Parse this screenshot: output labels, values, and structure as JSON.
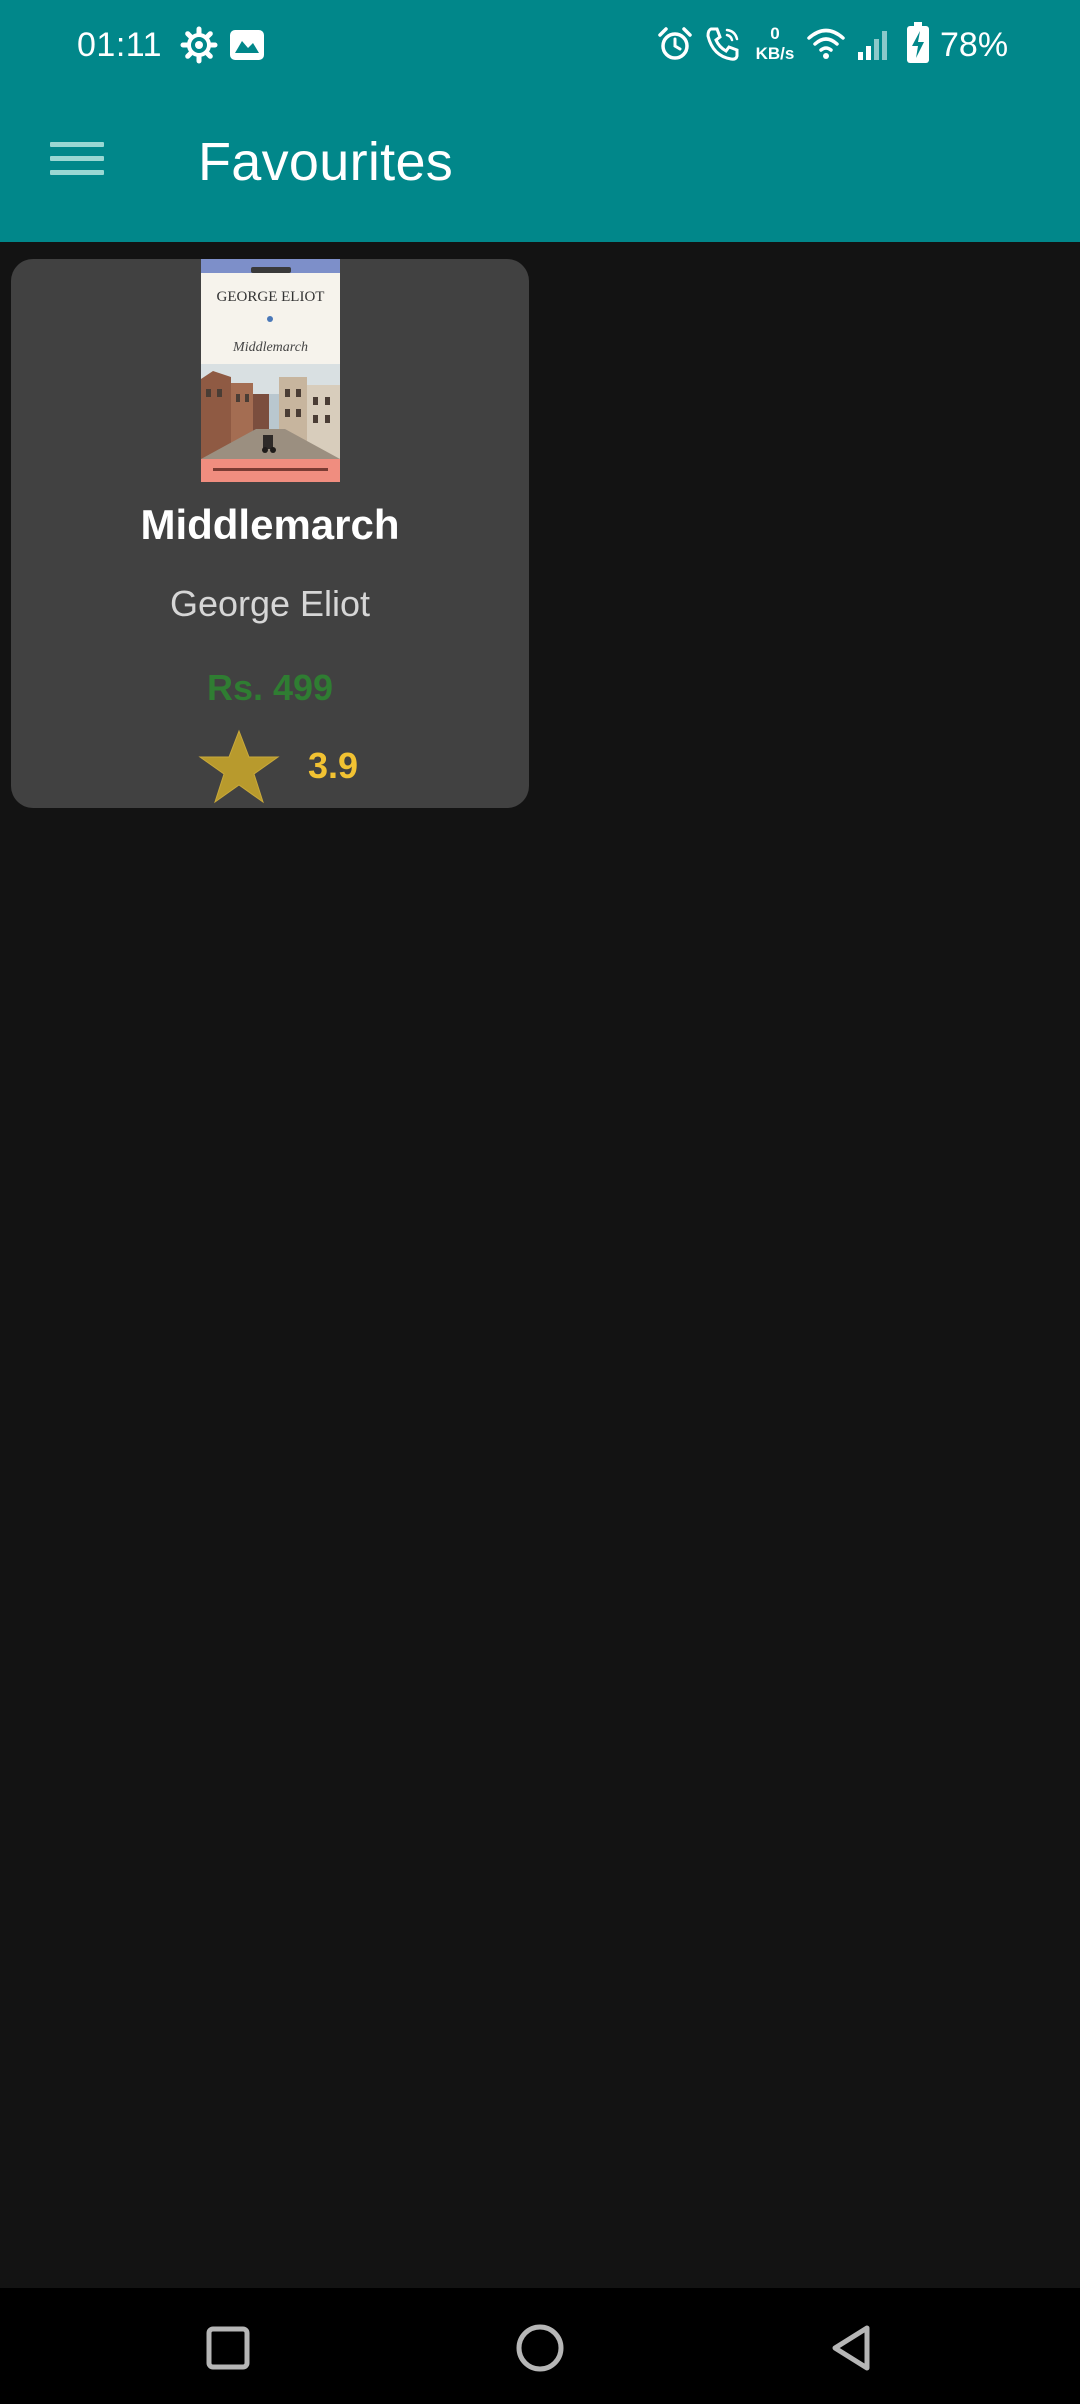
{
  "status_bar": {
    "time": "01:11",
    "speed_value": "0",
    "speed_unit": "KB/s",
    "battery": "78%",
    "icons": [
      "settings-icon",
      "gallery-icon",
      "alarm-icon",
      "wifi-call-icon",
      "wifi-icon",
      "signal-icon",
      "battery-charging-icon"
    ]
  },
  "app_bar": {
    "title": "Favourites",
    "menu_icon": "hamburger-menu-icon"
  },
  "favourites": [
    {
      "cover_author": "GEORGE ELIOT",
      "cover_title": "Middlemarch",
      "title": "Middlemarch",
      "author": "George Eliot",
      "price": "Rs. 499",
      "rating": "3.9",
      "rating_icon": "star-icon"
    }
  ],
  "colors": {
    "primary": "#01878a",
    "background": "#131313",
    "card": "#414141",
    "price": "#2f7d32",
    "rating": "#f2c232"
  },
  "nav_bar": {
    "buttons": [
      "recents-square-icon",
      "home-circle-icon",
      "back-triangle-icon"
    ]
  }
}
